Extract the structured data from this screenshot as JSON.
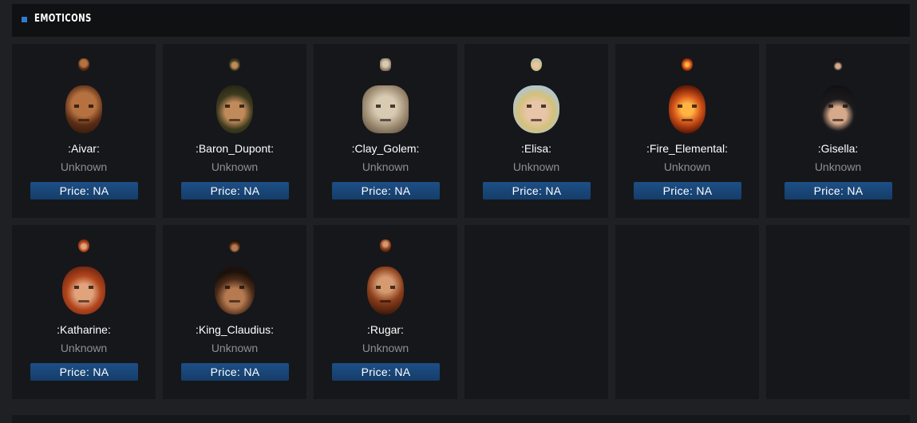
{
  "section": {
    "title": "EMOTICONS",
    "accent_color": "#2f7bd0"
  },
  "emoticons": [
    {
      "name": ":Aivar:",
      "status": "Unknown",
      "price": "Price: NA",
      "icon": "aivar-portrait-icon"
    },
    {
      "name": ":Baron_Dupont:",
      "status": "Unknown",
      "price": "Price: NA",
      "icon": "baron-dupont-portrait-icon"
    },
    {
      "name": ":Clay_Golem:",
      "status": "Unknown",
      "price": "Price: NA",
      "icon": "clay-golem-portrait-icon"
    },
    {
      "name": ":Elisa:",
      "status": "Unknown",
      "price": "Price: NA",
      "icon": "elisa-portrait-icon"
    },
    {
      "name": ":Fire_Elemental:",
      "status": "Unknown",
      "price": "Price: NA",
      "icon": "fire-elemental-portrait-icon"
    },
    {
      "name": ":Gisella:",
      "status": "Unknown",
      "price": "Price: NA",
      "icon": "gisella-portrait-icon"
    },
    {
      "name": ":Katharine:",
      "status": "Unknown",
      "price": "Price: NA",
      "icon": "katharine-portrait-icon"
    },
    {
      "name": ":King_Claudius:",
      "status": "Unknown",
      "price": "Price: NA",
      "icon": "king-claudius-portrait-icon"
    },
    {
      "name": ":Rugar:",
      "status": "Unknown",
      "price": "Price: NA",
      "icon": "rugar-portrait-icon"
    }
  ]
}
